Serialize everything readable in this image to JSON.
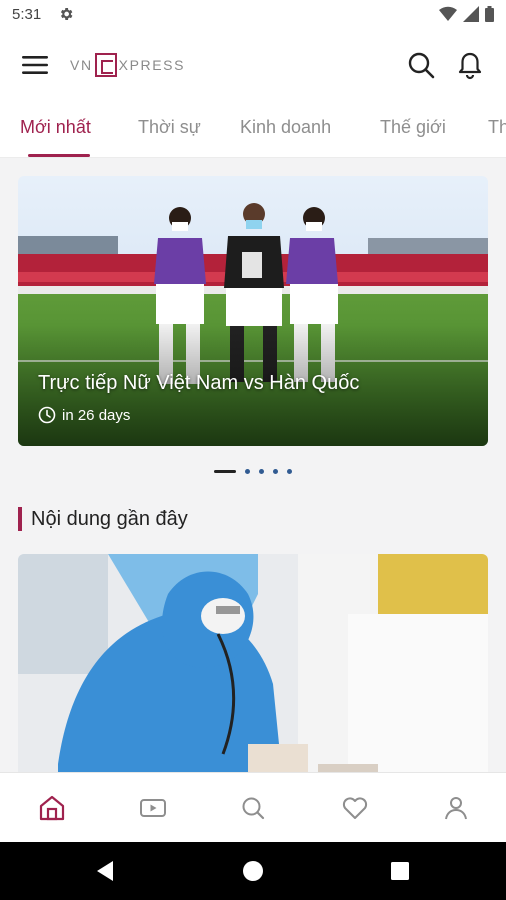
{
  "status_bar": {
    "time": "5:31",
    "icons": [
      "settings-icon",
      "wifi-icon",
      "signal-icon",
      "battery-icon"
    ]
  },
  "header": {
    "logo_left": "VN",
    "logo_right": "XPRESS",
    "icons": [
      "menu-icon",
      "search-icon",
      "bell-icon"
    ]
  },
  "tabs": [
    {
      "label": "Mới nhất",
      "active": true
    },
    {
      "label": "Thời sự",
      "active": false
    },
    {
      "label": "Kinh doanh",
      "active": false
    },
    {
      "label": "Thế giới",
      "active": false
    },
    {
      "label": "Th",
      "active": false
    }
  ],
  "hero": {
    "title": "Trực tiếp Nữ Việt Nam vs Hàn Quốc",
    "time": "in 26 days",
    "carousel_index": 1,
    "carousel_count": 5
  },
  "section": {
    "title": "Nội dung gần đây"
  },
  "bottom_nav": {
    "items": [
      "home-icon",
      "video-icon",
      "search-icon",
      "heart-icon",
      "profile-icon"
    ],
    "active": "home-icon"
  },
  "colors": {
    "brand": "#9f224e",
    "inactive_tab": "#8e8e8e",
    "content_bg": "#f3f3f4",
    "carousel_dot": "#315b92"
  }
}
